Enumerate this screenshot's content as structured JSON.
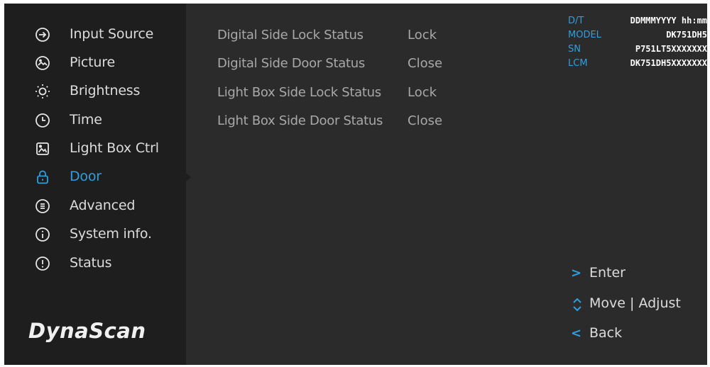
{
  "sidebar": {
    "items": [
      {
        "label": "Input Source",
        "icon": "input-source-icon"
      },
      {
        "label": "Picture",
        "icon": "picture-icon"
      },
      {
        "label": "Brightness",
        "icon": "brightness-icon"
      },
      {
        "label": "Time",
        "icon": "clock-icon"
      },
      {
        "label": "Light Box Ctrl",
        "icon": "image-icon"
      },
      {
        "label": "Door",
        "icon": "lock-icon",
        "active": true
      },
      {
        "label": "Advanced",
        "icon": "advanced-icon"
      },
      {
        "label": "System info.",
        "icon": "info-icon"
      },
      {
        "label": "Status",
        "icon": "alert-icon"
      }
    ],
    "logo": "DynaScan"
  },
  "status": {
    "rows": [
      {
        "name": "Digital Side Lock Status",
        "value": "Lock"
      },
      {
        "name": "Digital Side Door Status",
        "value": "Close"
      },
      {
        "name": "Light Box Side Lock Status",
        "value": "Lock"
      },
      {
        "name": "Light Box Side Door Status",
        "value": "Close"
      }
    ]
  },
  "device_info": {
    "rows": [
      {
        "key": "D/T",
        "value": "DDMMMYYYY hh:mm"
      },
      {
        "key": "MODEL",
        "value": "DK751DH5"
      },
      {
        "key": "SN",
        "value": "P751LT5XXXXXXX"
      },
      {
        "key": "LCM",
        "value": "DK751DH5XXXXXXX"
      }
    ]
  },
  "hints": {
    "enter": ">",
    "enter_label": "Enter",
    "move_label": "Move",
    "separator": "|",
    "adjust_label": "Adjust",
    "back": "<",
    "back_label": "Back"
  },
  "colors": {
    "accent": "#2f9fe0",
    "sidebar_bg": "#1e1e1e",
    "content_bg": "#2b2b2b",
    "text": "#dcdcdc",
    "status_text": "#a8a8a8"
  }
}
